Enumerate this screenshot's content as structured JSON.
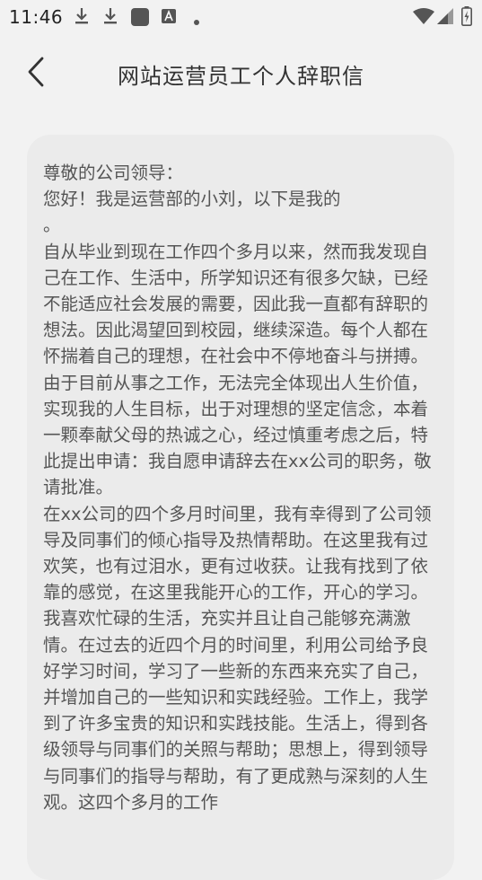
{
  "status_bar": {
    "time": "11:46",
    "left_icons": [
      "download-icon",
      "download-icon",
      "app-square-icon",
      "a-badge-icon",
      "dot-icon"
    ],
    "right_icons": [
      "wifi-icon",
      "signal-icon",
      "battery-icon"
    ]
  },
  "app_bar": {
    "title": "网站运营员工个人辞职信",
    "back_icon": "back-arrow-icon"
  },
  "letter": {
    "salutation": "尊敬的公司领导：",
    "greeting": "您好！我是运营部的小刘，以下是我的",
    "greeting_tail": "。",
    "paragraphs": [
      "自从毕业到现在工作四个多月以来，然而我发现自己在工作、生活中，所学知识还有很多欠缺，已经不能适应社会发展的需要，因此我一直都有辞职的想法。因此渴望回到校园，继续深造。每个人都在怀揣着自己的理想，在社会中不停地奋斗与拼搏。由于目前从事之工作，无法完全体现出人生价值，实现我的人生目标，出于对理想的坚定信念，本着一颗奉献父母的热诚之心，经过慎重考虑之后，特此提出申请：我自愿申请辞去在xx公司的职务，敬请批准。",
      "在xx公司的四个多月时间里，我有幸得到了公司领导及同事们的倾心指导及热情帮助。在这里我有过欢笑，也有过泪水，更有过收获。让我有找到了依靠的感觉，在这里我能开心的工作，开心的学习。我喜欢忙碌的生活，充实并且让自己能够充满激情。在过去的近四个月的时间里，利用公司给予良好学习时间，学习了一些新的东西来充实了自己，并增加自己的一些知识和实践经验。工作上，我学到了许多宝贵的知识和实践技能。生活上，得到各级领导与同事们的关照与帮助；思想上，得到领导与同事们的指导与帮助，有了更成熟与深刻的人生观。这四个多月的工作"
    ]
  }
}
